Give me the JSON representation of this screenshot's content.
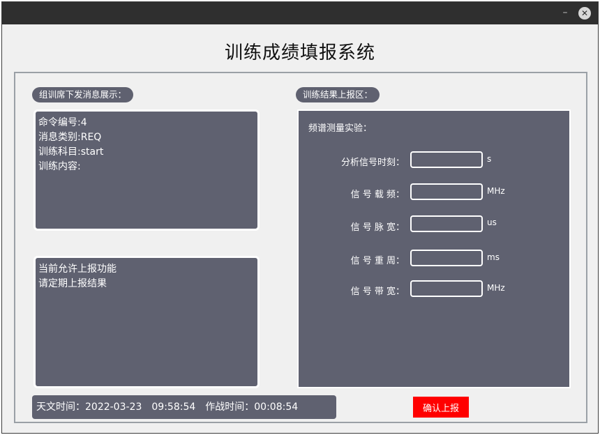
{
  "window": {
    "title": "训练成绩填报系统",
    "minimize_symbol": "–",
    "close_symbol": "✕"
  },
  "left": {
    "section_label": "组训席下发消息展示：",
    "message_box": {
      "lines": [
        "命令编号:4",
        "消息类别:REQ",
        "训练科目:start",
        "训练内容:"
      ]
    },
    "notice_box": {
      "lines": [
        "当前允许上报功能",
        "请定期上报结果"
      ]
    }
  },
  "right": {
    "section_label": "训练结果上报区：",
    "experiment_title": "频谱测量实验：",
    "fields": [
      {
        "label": "分析信号时刻：",
        "value": "",
        "unit": "s"
      },
      {
        "label": "信 号 载 频：",
        "value": "",
        "unit": "MHz"
      },
      {
        "label": "信 号 脉 宽：",
        "value": "",
        "unit": "us"
      },
      {
        "label": "信 号 重 周：",
        "value": "",
        "unit": "ms"
      },
      {
        "label": "信 号 带 宽：",
        "value": "",
        "unit": "MHz"
      }
    ]
  },
  "status": {
    "astro_time_label": "天文时间：",
    "astro_date": "2022-03-23",
    "astro_time": "09:58:54",
    "combat_time_label": "作战时间：",
    "combat_time": "00:08:54"
  },
  "actions": {
    "confirm_label": "确认上报"
  },
  "colors": {
    "panel_bg": "#5f6170",
    "window_bg": "#f0f0f0",
    "titlebar_bg": "#2f2f2f",
    "confirm_bg": "#ff0000"
  }
}
